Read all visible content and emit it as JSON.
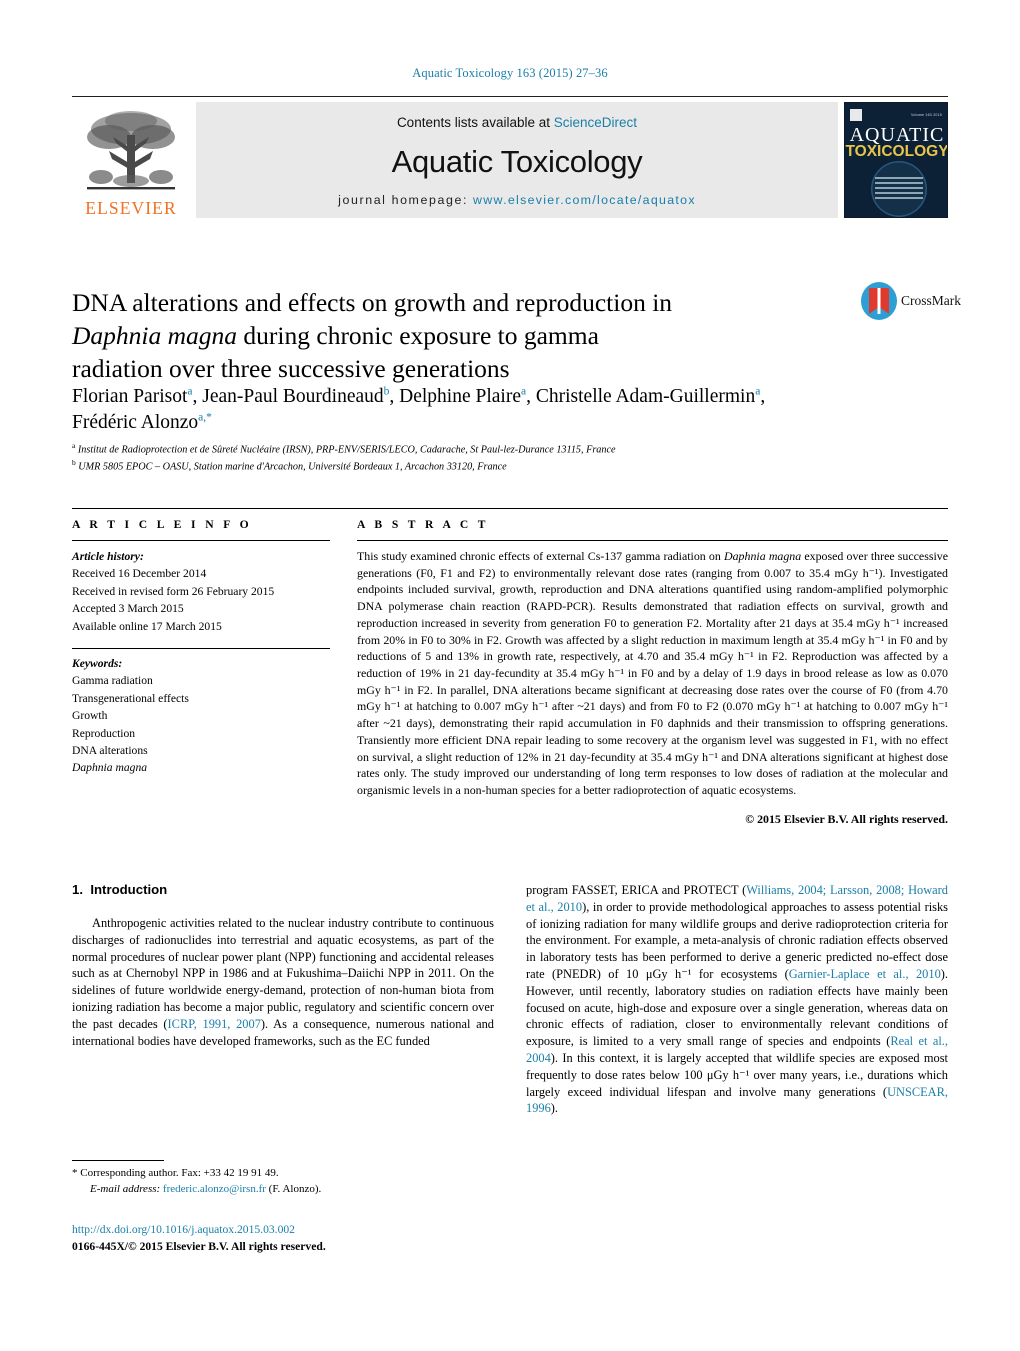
{
  "running_head": "Aquatic Toxicology 163 (2015) 27–36",
  "masthead": {
    "contents_prefix": "Contents lists available at ",
    "sciencedirect": "ScienceDirect",
    "journal_title": "Aquatic Toxicology",
    "homepage_prefix": "journal homepage: ",
    "homepage_url": "www.elsevier.com/locate/aquatox",
    "publisher": "ELSEVIER",
    "cover": {
      "word1": "AQUATIC",
      "word2": "TOXICOLOGY",
      "top_left_label": "ELSEVIER",
      "top_right_label": "Volume 163  2015"
    }
  },
  "crossmark": {
    "label": "CrossMark"
  },
  "title": {
    "line1": "DNA alterations and effects on growth and reproduction in",
    "line2_italic": "Daphnia magna",
    "line2_rest": " during chronic exposure to gamma",
    "line3": "radiation over three successive generations"
  },
  "authors": {
    "list": [
      {
        "name": "Florian Parisot",
        "sup": "a"
      },
      {
        "name": "Jean-Paul Bourdineaud",
        "sup": "b"
      },
      {
        "name": "Delphine Plaire",
        "sup": "a"
      },
      {
        "name": "Christelle Adam-Guillermin",
        "sup": "a"
      },
      {
        "name": "Frédéric Alonzo",
        "sup": "a,*"
      }
    ],
    "affiliations": [
      {
        "marker": "a",
        "text": "Institut de Radioprotection et de Sûreté Nucléaire (IRSN), PRP-ENV/SERIS/LECO, Cadarache, St Paul-lez-Durance 13115, France"
      },
      {
        "marker": "b",
        "text": "UMR 5805 EPOC – OASU, Station marine d'Arcachon, Université Bordeaux 1, Arcachon 33120, France"
      }
    ]
  },
  "article_info": {
    "heading": "A R T I C L E   I N F O",
    "history_title": "Article history:",
    "history": [
      "Received 16 December 2014",
      "Received in revised form 26 February 2015",
      "Accepted 3 March 2015",
      "Available online 17 March 2015"
    ],
    "keywords_title": "Keywords:",
    "keywords": [
      "Gamma radiation",
      "Transgenerational effects",
      "Growth",
      "Reproduction",
      "DNA alterations",
      "Daphnia magna"
    ],
    "keyword_italic_index": 5
  },
  "abstract": {
    "heading": "A B S T R A C T",
    "paragraph_parts": [
      "This study examined chronic effects of external Cs-137 gamma radiation on ",
      "Daphnia magna",
      " exposed over three successive generations (F0, F1 and F2) to environmentally relevant dose rates (ranging from 0.007 to 35.4 mGy h⁻¹). Investigated endpoints included survival, growth, reproduction and DNA alterations quantified using random-amplified polymorphic DNA polymerase chain reaction (RAPD-PCR). Results demonstrated that radiation effects on survival, growth and reproduction increased in severity from generation F0 to generation F2. Mortality after 21 days at 35.4 mGy h⁻¹ increased from 20% in F0 to 30% in F2. Growth was affected by a slight reduction in maximum length at 35.4 mGy h⁻¹ in F0 and by reductions of 5 and 13% in growth rate, respectively, at 4.70 and 35.4 mGy h⁻¹ in F2. Reproduction was affected by a reduction of 19% in 21 day-fecundity at 35.4 mGy h⁻¹ in F0 and by a delay of 1.9 days in brood release as low as 0.070 mGy h⁻¹ in F2. In parallel, DNA alterations became significant at decreasing dose rates over the course of F0 (from 4.70 mGy h⁻¹ at hatching to 0.007 mGy h⁻¹ after ~21 days) and from F0 to F2 (0.070 mGy h⁻¹ at hatching to 0.007 mGy h⁻¹ after ~21 days), demonstrating their rapid accumulation in F0 daphnids and their transmission to offspring generations. Transiently more efficient DNA repair leading to some recovery at the organism level was suggested in F1, with no effect on survival, a slight reduction of 12% in 21 day-fecundity at 35.4 mGy h⁻¹ and DNA alterations significant at highest dose rates only. The study improved our understanding of long term responses to low doses of radiation at the molecular and organismic levels in a non-human species for a better radioprotection of aquatic ecosystems."
    ],
    "copyright": "© 2015 Elsevier B.V. All rights reserved."
  },
  "body": {
    "section_number": "1.",
    "section_title": "Introduction",
    "left_paragraph_parts": [
      "Anthropogenic activities related to the nuclear industry contribute to continuous discharges of radionuclides into terrestrial and aquatic ecosystems, as part of the normal procedures of nuclear power plant (NPP) functioning and accidental releases such as at Chernobyl NPP in 1986 and at Fukushima–Daiichi NPP in 2011. On the sidelines of future worldwide energy-demand, protection of non-human biota from ionizing radiation has become a major public, regulatory and scientific concern over the past decades (",
      "ICRP, 1991, 2007",
      "). As a consequence, numerous national and international bodies have developed frameworks, such as the EC funded"
    ],
    "right_parts": [
      "program FASSET, ERICA and PROTECT (",
      "Williams, 2004; Larsson, 2008; Howard et al., 2010",
      "), in order to provide methodological approaches to assess potential risks of ionizing radiation for many wildlife groups and derive radioprotection criteria for the environment. For example, a meta-analysis of chronic radiation effects observed in laboratory tests has been performed to derive a generic predicted no-effect dose rate (PNEDR) of 10 μGy h⁻¹ for ecosystems (",
      "Garnier-Laplace et al., 2010",
      "). However, until recently, laboratory studies on radiation effects have mainly been focused on acute, high-dose and exposure over a single generation, whereas data on chronic effects of radiation, closer to environmentally relevant conditions of exposure, is limited to a very small range of species and endpoints (",
      "Real et al., 2004",
      "). In this context, it is largely accepted that wildlife species are exposed most frequently to dose rates below 100 μGy h⁻¹ over many years, i.e., durations which largely exceed individual lifespan and involve many generations (",
      "UNSCEAR, 1996",
      ")."
    ]
  },
  "footnote": {
    "corresponding": "* Corresponding author. Fax: +33 42 19 91 49.",
    "email_label": "E-mail address:",
    "email": "frederic.alonzo@irsn.fr",
    "email_suffix": " (F. Alonzo)."
  },
  "doi": {
    "url": "http://dx.doi.org/10.1016/j.aquatox.2015.03.002",
    "issn_line": "0166-445X/© 2015 Elsevier B.V. All rights reserved."
  },
  "colors": {
    "link": "#1a7fa8",
    "elsevier_orange": "#F37021",
    "cover_bg": "#0d2136",
    "cover_yellow": "#e8c54a"
  }
}
